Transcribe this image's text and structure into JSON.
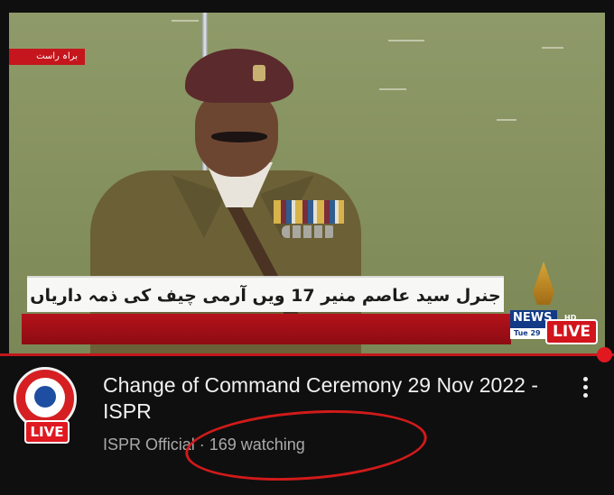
{
  "video": {
    "channel_tag": "براہ راست",
    "ticker_headline": "جنرل سید عاصم منیر 17 ویں آرمی چیف کی ذمہ داریاں سنبھالیں گے",
    "news_logo": "NEWS",
    "news_hd": "HD",
    "news_date": "Tue 29",
    "live_badge": "LIVE"
  },
  "player": {
    "progress_percent": 100,
    "accent_color": "#e1181f"
  },
  "info": {
    "title": "Change of Command Ceremony 29 Nov 2022 - ISPR",
    "channel_name": "ISPR Official",
    "separator": "·",
    "viewers": "169 watching",
    "avatar_live": "LIVE",
    "more_icon": "more-vert-icon"
  }
}
